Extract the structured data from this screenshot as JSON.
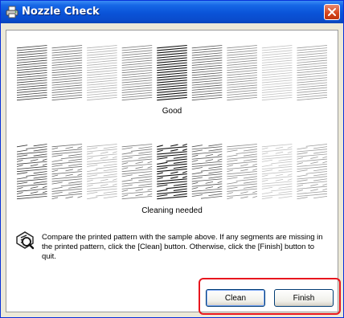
{
  "window": {
    "title": "Nozzle Check"
  },
  "patterns": {
    "good_label": "Good",
    "cleaning_label": "Cleaning needed"
  },
  "message": "Compare the printed pattern with the sample above. If any segments are missing in the printed pattern, click the [Clean] button. Otherwise, click the [Finish] button to quit.",
  "buttons": {
    "clean_label": "Clean",
    "finish_label": "Finish"
  },
  "icons": {
    "title": "printer-icon",
    "close": "close-icon",
    "info": "nozzle-check-icon"
  },
  "colors": {
    "titlebar": "#0a53d8",
    "highlight_border": "#e8161e",
    "window_face": "#ece9d8"
  }
}
